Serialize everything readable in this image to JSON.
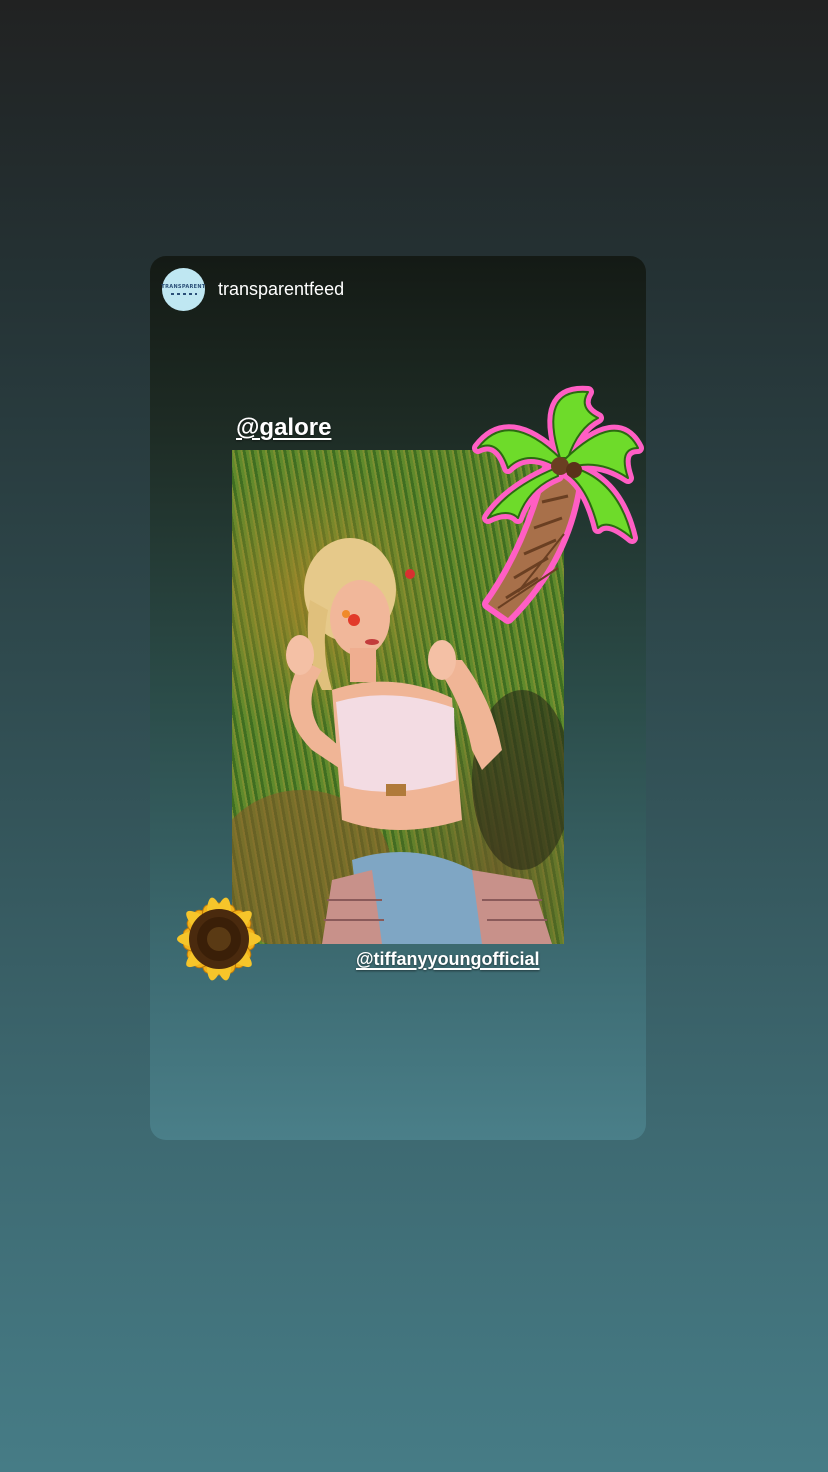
{
  "story": {
    "username": "transparentfeed",
    "avatar_text": "TRANSPARENT",
    "mention_top": "@galore",
    "mention_bottom": "@tiffanyyoungofficial"
  },
  "stickers": {
    "palm_tree": "palm-tree-sticker",
    "sunflower": "sunflower-sticker"
  },
  "colors": {
    "palm_outline": "#ff5ec4",
    "palm_leaves": "#6edb2a",
    "avatar_bg": "#bfe7f2"
  }
}
